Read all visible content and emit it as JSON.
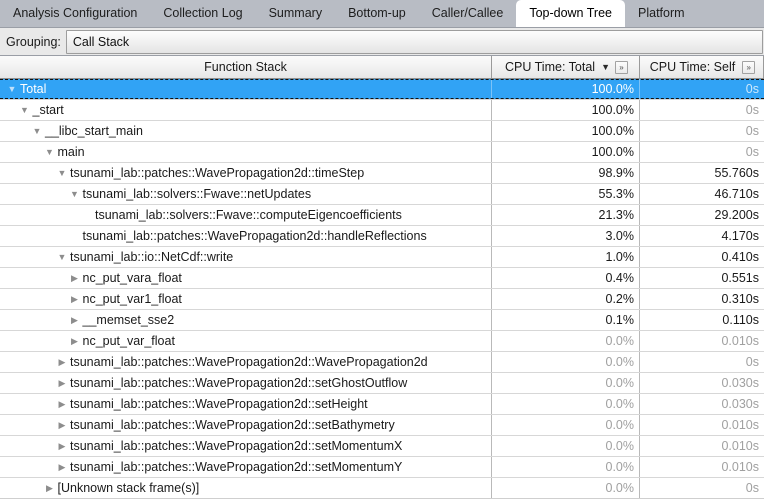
{
  "tabs": [
    {
      "label": "Analysis Configuration",
      "selected": false
    },
    {
      "label": "Collection Log",
      "selected": false
    },
    {
      "label": "Summary",
      "selected": false
    },
    {
      "label": "Bottom-up",
      "selected": false
    },
    {
      "label": "Caller/Callee",
      "selected": false
    },
    {
      "label": "Top-down Tree",
      "selected": true
    },
    {
      "label": "Platform",
      "selected": false
    }
  ],
  "grouping": {
    "label": "Grouping:",
    "value": "Call Stack"
  },
  "colors": {
    "selection": "#31a3f5",
    "tabbar": "#b8bcc4",
    "header": "#f0f0f0",
    "dim_text": "#a0a0a0"
  },
  "table": {
    "columns": [
      {
        "label": "Function Stack",
        "sort": "",
        "expand_icon": "»",
        "has_expand": false
      },
      {
        "label": "CPU Time: Total",
        "sort": "▼",
        "expand_icon": "»",
        "has_expand": true
      },
      {
        "label": "CPU Time: Self",
        "sort": "",
        "expand_icon": "»",
        "has_expand": true
      }
    ],
    "rows": [
      {
        "name": "Total",
        "depth": 0,
        "tri": "▼",
        "total": "100.0%",
        "self": "0s",
        "self_dim": true,
        "total_dim": false,
        "selected": true
      },
      {
        "name": "_start",
        "depth": 1,
        "tri": "▼",
        "total": "100.0%",
        "self": "0s",
        "self_dim": true,
        "total_dim": false,
        "selected": false
      },
      {
        "name": "__libc_start_main",
        "depth": 2,
        "tri": "▼",
        "total": "100.0%",
        "self": "0s",
        "self_dim": true,
        "total_dim": false,
        "selected": false
      },
      {
        "name": "main",
        "depth": 3,
        "tri": "▼",
        "total": "100.0%",
        "self": "0s",
        "self_dim": true,
        "total_dim": false,
        "selected": false
      },
      {
        "name": "tsunami_lab::patches::WavePropagation2d::timeStep",
        "depth": 4,
        "tri": "▼",
        "total": "98.9%",
        "self": "55.760s",
        "self_dim": false,
        "total_dim": false,
        "selected": false
      },
      {
        "name": "tsunami_lab::solvers::Fwave::netUpdates",
        "depth": 5,
        "tri": "▼",
        "total": "55.3%",
        "self": "46.710s",
        "self_dim": false,
        "total_dim": false,
        "selected": false
      },
      {
        "name": "tsunami_lab::solvers::Fwave::computeEigencoefficients",
        "depth": 6,
        "tri": "",
        "total": "21.3%",
        "self": "29.200s",
        "self_dim": false,
        "total_dim": false,
        "selected": false
      },
      {
        "name": "tsunami_lab::patches::WavePropagation2d::handleReflections",
        "depth": 5,
        "tri": "",
        "total": "3.0%",
        "self": "4.170s",
        "self_dim": false,
        "total_dim": false,
        "selected": false
      },
      {
        "name": "tsunami_lab::io::NetCdf::write",
        "depth": 4,
        "tri": "▼",
        "total": "1.0%",
        "self": "0.410s",
        "self_dim": false,
        "total_dim": false,
        "selected": false
      },
      {
        "name": "nc_put_vara_float",
        "depth": 5,
        "tri": "▶",
        "total": "0.4%",
        "self": "0.551s",
        "self_dim": false,
        "total_dim": false,
        "selected": false
      },
      {
        "name": "nc_put_var1_float",
        "depth": 5,
        "tri": "▶",
        "total": "0.2%",
        "self": "0.310s",
        "self_dim": false,
        "total_dim": false,
        "selected": false
      },
      {
        "name": "__memset_sse2",
        "depth": 5,
        "tri": "▶",
        "total": "0.1%",
        "self": "0.110s",
        "self_dim": false,
        "total_dim": false,
        "selected": false
      },
      {
        "name": "nc_put_var_float",
        "depth": 5,
        "tri": "▶",
        "total": "0.0%",
        "self": "0.010s",
        "self_dim": true,
        "total_dim": true,
        "selected": false
      },
      {
        "name": "tsunami_lab::patches::WavePropagation2d::WavePropagation2d",
        "depth": 4,
        "tri": "▶",
        "total": "0.0%",
        "self": "0s",
        "self_dim": true,
        "total_dim": true,
        "selected": false
      },
      {
        "name": "tsunami_lab::patches::WavePropagation2d::setGhostOutflow",
        "depth": 4,
        "tri": "▶",
        "total": "0.0%",
        "self": "0.030s",
        "self_dim": true,
        "total_dim": true,
        "selected": false
      },
      {
        "name": "tsunami_lab::patches::WavePropagation2d::setHeight",
        "depth": 4,
        "tri": "▶",
        "total": "0.0%",
        "self": "0.030s",
        "self_dim": true,
        "total_dim": true,
        "selected": false
      },
      {
        "name": "tsunami_lab::patches::WavePropagation2d::setBathymetry",
        "depth": 4,
        "tri": "▶",
        "total": "0.0%",
        "self": "0.010s",
        "self_dim": true,
        "total_dim": true,
        "selected": false
      },
      {
        "name": "tsunami_lab::patches::WavePropagation2d::setMomentumX",
        "depth": 4,
        "tri": "▶",
        "total": "0.0%",
        "self": "0.010s",
        "self_dim": true,
        "total_dim": true,
        "selected": false
      },
      {
        "name": "tsunami_lab::patches::WavePropagation2d::setMomentumY",
        "depth": 4,
        "tri": "▶",
        "total": "0.0%",
        "self": "0.010s",
        "self_dim": true,
        "total_dim": true,
        "selected": false
      },
      {
        "name": "[Unknown stack frame(s)]",
        "depth": 3,
        "tri": "▶",
        "total": "0.0%",
        "self": "0s",
        "self_dim": true,
        "total_dim": true,
        "selected": false
      }
    ]
  }
}
